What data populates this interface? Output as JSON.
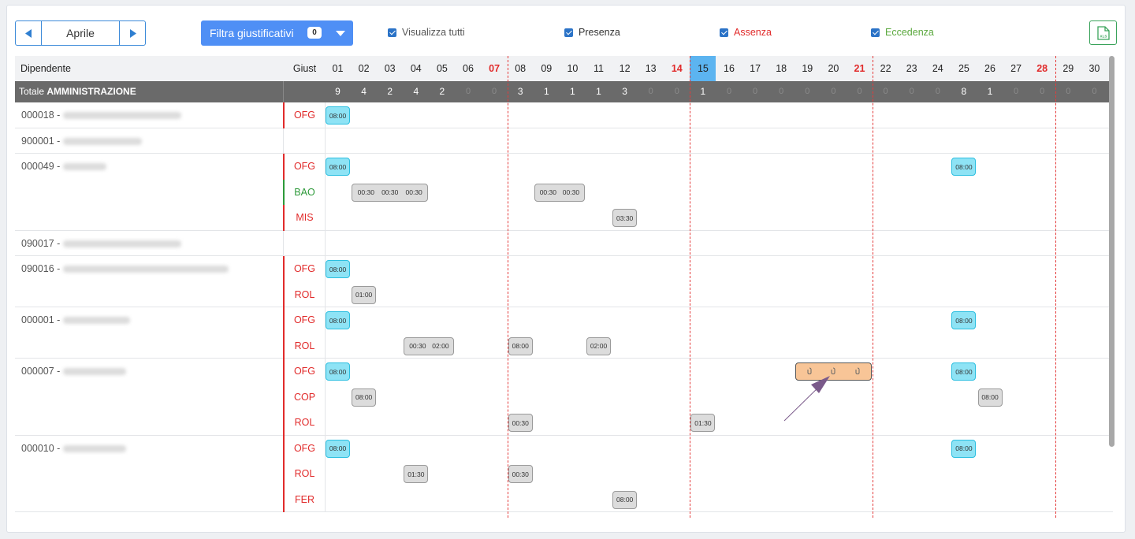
{
  "toolbar": {
    "month": "Aprile",
    "filter_label": "Filtra giustificativi",
    "filter_count": "0",
    "checks": [
      {
        "label": "Visualizza tutti",
        "color": "#555555"
      },
      {
        "label": "Presenza",
        "color": "#333333"
      },
      {
        "label": "Assenza",
        "color": "#e12b2b"
      },
      {
        "label": "Eccedenza",
        "color": "#5aa83d"
      }
    ],
    "xls_label": "XLS"
  },
  "header": {
    "employee": "Dipendente",
    "giust": "Giust",
    "days": [
      "01",
      "02",
      "03",
      "04",
      "05",
      "06",
      "07",
      "08",
      "09",
      "10",
      "11",
      "12",
      "13",
      "14",
      "15",
      "16",
      "17",
      "18",
      "19",
      "20",
      "21",
      "22",
      "23",
      "24",
      "25",
      "26",
      "27",
      "28",
      "29",
      "30"
    ],
    "red_days": [
      "07",
      "14",
      "21",
      "28"
    ],
    "today": "15"
  },
  "total": {
    "prefix": "Totale",
    "label": "AMMINISTRAZIONE",
    "values": [
      "9",
      "4",
      "2",
      "4",
      "2",
      "0",
      "0",
      "3",
      "1",
      "1",
      "1",
      "3",
      "0",
      "0",
      "1",
      "0",
      "0",
      "0",
      "0",
      "0",
      "0",
      "0",
      "0",
      "0",
      "8",
      "1",
      "0",
      "0",
      "0",
      "0"
    ]
  },
  "colors": {
    "absence": "#e12b2b",
    "presence": "#2e9a3a"
  },
  "employees": [
    {
      "code": "000018 -",
      "rows": [
        {
          "giust": "OFG",
          "type": "absence",
          "pills": [
            {
              "day": 1,
              "span": 1,
              "style": "blue",
              "times": [
                "08:00"
              ]
            }
          ]
        }
      ]
    },
    {
      "code": "900001 -",
      "rows": [
        {
          "giust": "",
          "type": "none",
          "pills": []
        }
      ]
    },
    {
      "code": "000049 -",
      "rows": [
        {
          "giust": "OFG",
          "type": "absence",
          "pills": [
            {
              "day": 1,
              "span": 1,
              "style": "blue",
              "times": [
                "08:00"
              ]
            },
            {
              "day": 25,
              "span": 1,
              "style": "blue",
              "times": [
                "08:00"
              ]
            }
          ]
        },
        {
          "giust": "BAO",
          "type": "presence",
          "pills": [
            {
              "day": 2,
              "span": 3,
              "style": "gray",
              "times": [
                "00:30",
                "00:30",
                "00:30"
              ]
            },
            {
              "day": 9,
              "span": 2,
              "style": "gray",
              "times": [
                "00:30",
                "00:30"
              ]
            }
          ]
        },
        {
          "giust": "MIS",
          "type": "absence",
          "pills": [
            {
              "day": 12,
              "span": 1,
              "style": "gray",
              "times": [
                "03:30"
              ]
            }
          ]
        }
      ]
    },
    {
      "code": "090017 -",
      "rows": [
        {
          "giust": "",
          "type": "none",
          "pills": []
        }
      ]
    },
    {
      "code": "090016 -",
      "rows": [
        {
          "giust": "OFG",
          "type": "absence",
          "pills": [
            {
              "day": 1,
              "span": 1,
              "style": "blue",
              "times": [
                "08:00"
              ]
            }
          ]
        },
        {
          "giust": "ROL",
          "type": "absence",
          "pills": [
            {
              "day": 2,
              "span": 1,
              "style": "gray",
              "times": [
                "01:00"
              ]
            }
          ]
        }
      ]
    },
    {
      "code": "000001 -",
      "rows": [
        {
          "giust": "OFG",
          "type": "absence",
          "pills": [
            {
              "day": 1,
              "span": 1,
              "style": "blue",
              "times": [
                "08:00"
              ]
            },
            {
              "day": 25,
              "span": 1,
              "style": "blue",
              "times": [
                "08:00"
              ]
            }
          ]
        },
        {
          "giust": "ROL",
          "type": "absence",
          "pills": [
            {
              "day": 4,
              "span": 2,
              "style": "gray",
              "times": [
                "00:30",
                "02:00"
              ]
            },
            {
              "day": 8,
              "span": 1,
              "style": "gray",
              "times": [
                "08:00"
              ]
            },
            {
              "day": 11,
              "span": 1,
              "style": "gray",
              "times": [
                "02:00"
              ]
            }
          ]
        }
      ]
    },
    {
      "code": "000007 -",
      "rows": [
        {
          "giust": "OFG",
          "type": "absence",
          "pills": [
            {
              "day": 1,
              "span": 1,
              "style": "blue",
              "times": [
                "08:00"
              ]
            },
            {
              "day": 19,
              "span": 3,
              "style": "orange",
              "times": [
                "clip",
                "clip",
                "clip"
              ]
            },
            {
              "day": 25,
              "span": 1,
              "style": "blue",
              "times": [
                "08:00"
              ]
            }
          ]
        },
        {
          "giust": "COP",
          "type": "absence",
          "pills": [
            {
              "day": 2,
              "span": 1,
              "style": "gray",
              "times": [
                "08:00"
              ]
            },
            {
              "day": 26,
              "span": 1,
              "style": "gray",
              "times": [
                "08:00"
              ]
            }
          ]
        },
        {
          "giust": "ROL",
          "type": "absence",
          "pills": [
            {
              "day": 8,
              "span": 1,
              "style": "gray",
              "times": [
                "00:30"
              ]
            },
            {
              "day": 15,
              "span": 1,
              "style": "gray",
              "times": [
                "01:30"
              ]
            }
          ]
        }
      ]
    },
    {
      "code": "000010 -",
      "rows": [
        {
          "giust": "OFG",
          "type": "absence",
          "pills": [
            {
              "day": 1,
              "span": 1,
              "style": "blue",
              "times": [
                "08:00"
              ]
            },
            {
              "day": 25,
              "span": 1,
              "style": "blue",
              "times": [
                "08:00"
              ]
            }
          ]
        },
        {
          "giust": "ROL",
          "type": "absence",
          "pills": [
            {
              "day": 4,
              "span": 1,
              "style": "gray",
              "times": [
                "01:30"
              ]
            },
            {
              "day": 8,
              "span": 1,
              "style": "gray",
              "times": [
                "00:30"
              ]
            }
          ]
        },
        {
          "giust": "FER",
          "type": "absence",
          "pills": [
            {
              "day": 12,
              "span": 1,
              "style": "gray",
              "times": [
                "08:00"
              ]
            }
          ]
        }
      ]
    }
  ]
}
